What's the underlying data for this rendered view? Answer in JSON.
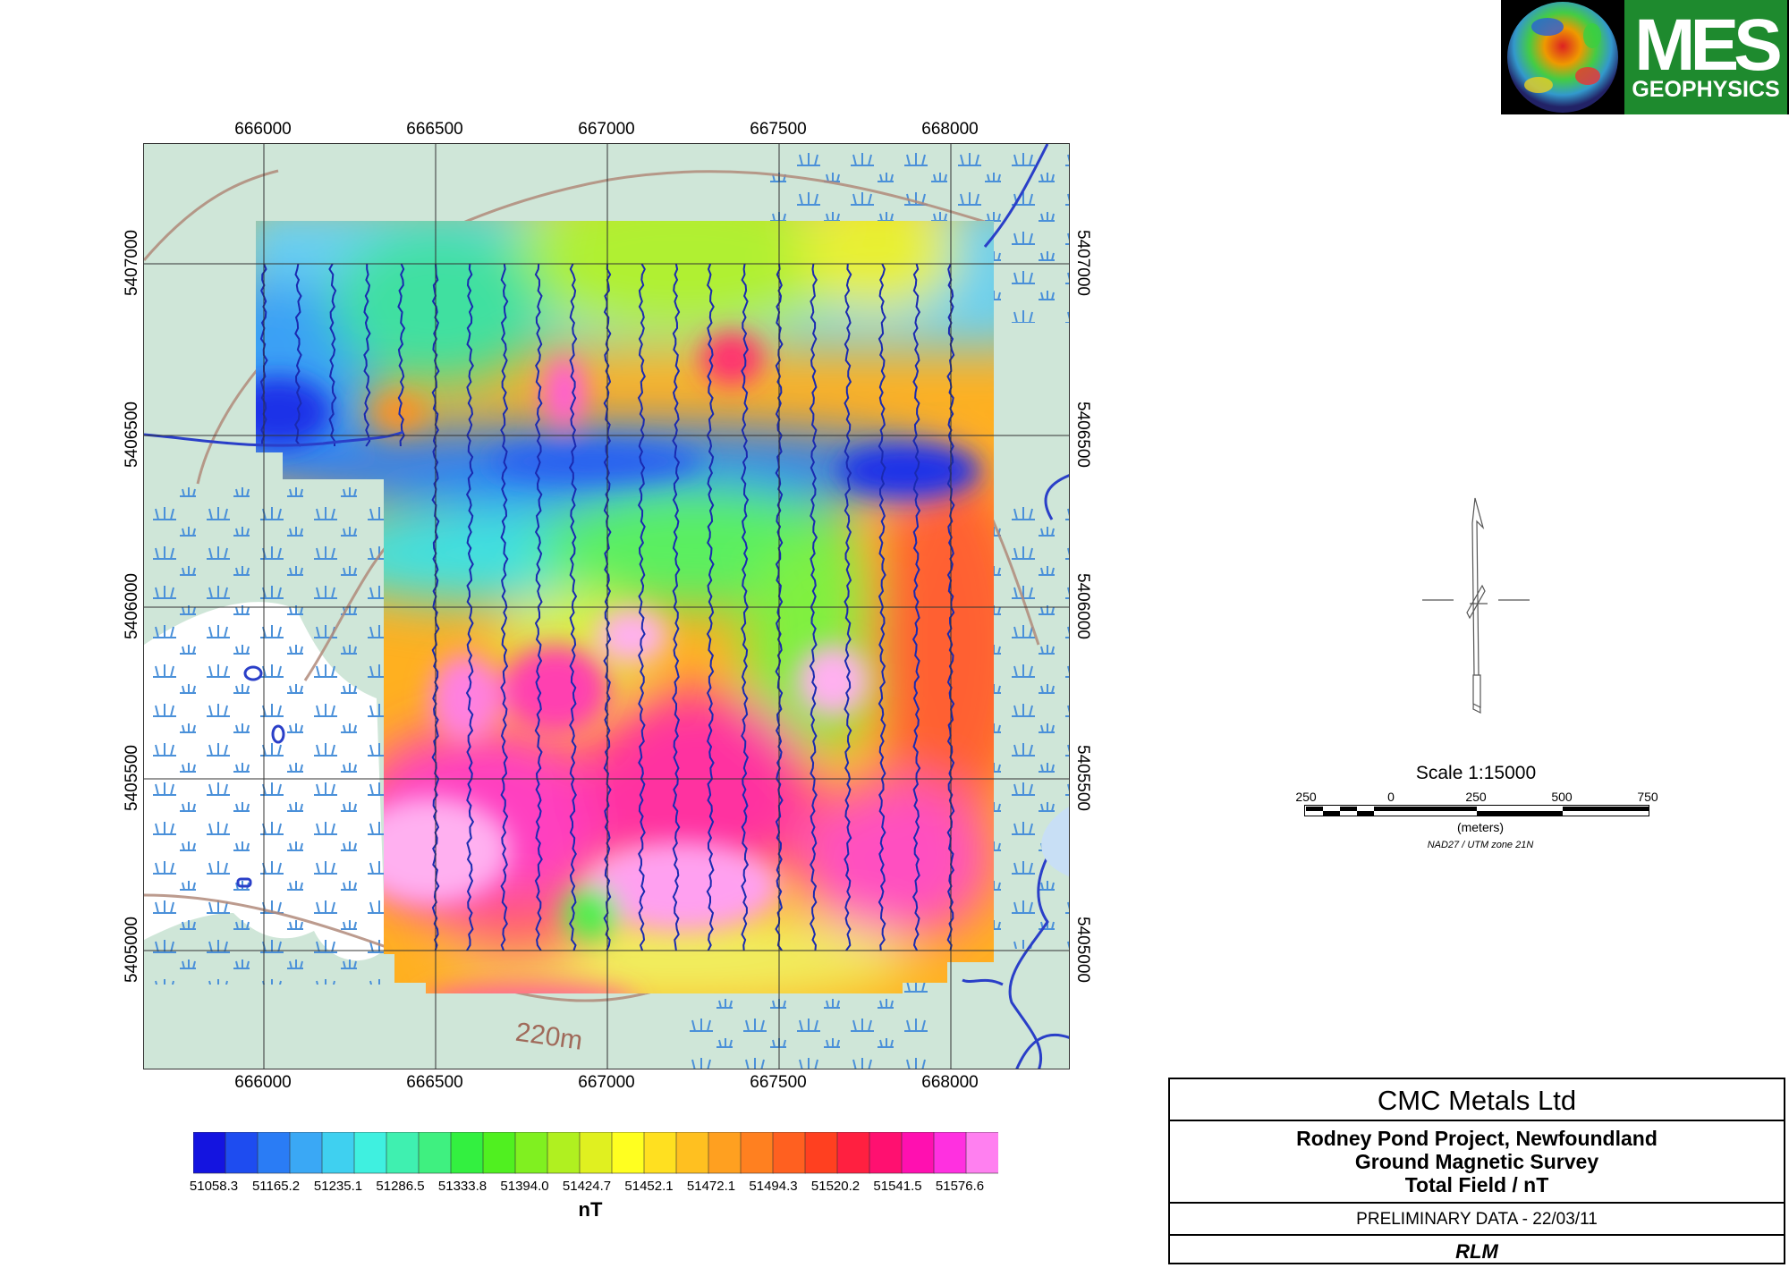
{
  "logo": {
    "text_main": "MES",
    "text_sub": "GEOPHYSICS",
    "bg_color": "#1e8a2e"
  },
  "map": {
    "x_ticks": [
      "666000",
      "666500",
      "667000",
      "667500",
      "668000"
    ],
    "y_ticks": [
      "5407000",
      "5406500",
      "5406000",
      "5405500",
      "5405000"
    ],
    "contour_label": "220m",
    "grid_color": "#333333",
    "background_color": "#cfe6d8",
    "water_color": "#2a3fc8",
    "wetland_symbol_color": "#4a90d9"
  },
  "north_arrow": {
    "icon": "north-arrow-icon"
  },
  "scale": {
    "title": "Scale 1:15000",
    "ticks": [
      "250",
      "0",
      "250",
      "500",
      "750"
    ],
    "units": "(meters)",
    "projection": "NAD27 / UTM zone 21N"
  },
  "colorbar": {
    "values": [
      "51058.3",
      "51165.2",
      "51235.1",
      "51286.5",
      "51333.8",
      "51394.0",
      "51424.7",
      "51452.1",
      "51472.1",
      "51494.3",
      "51520.2",
      "51541.5",
      "51576.6"
    ],
    "unit": "nT",
    "colors": [
      "#1414e0",
      "#1e4cf0",
      "#2a7cf5",
      "#3aa8f5",
      "#3fd0f0",
      "#3ff0e0",
      "#3ff0b0",
      "#3ff080",
      "#33f040",
      "#50f020",
      "#80f020",
      "#b0f020",
      "#e0f020",
      "#ffff20",
      "#ffe020",
      "#ffc020",
      "#ffa020",
      "#ff8020",
      "#ff6020",
      "#ff4020",
      "#ff2040",
      "#ff1070",
      "#ff10b0",
      "#ff30e0",
      "#ff80f0"
    ]
  },
  "title_block": {
    "company": "CMC Metals Ltd",
    "project_line1": "Rodney Pond Project, Newfoundland",
    "project_line2": "Ground Magnetic Survey",
    "project_line3": "Total Field / nT",
    "status": "PRELIMINARY DATA - 22/03/11",
    "author": "RLM"
  }
}
